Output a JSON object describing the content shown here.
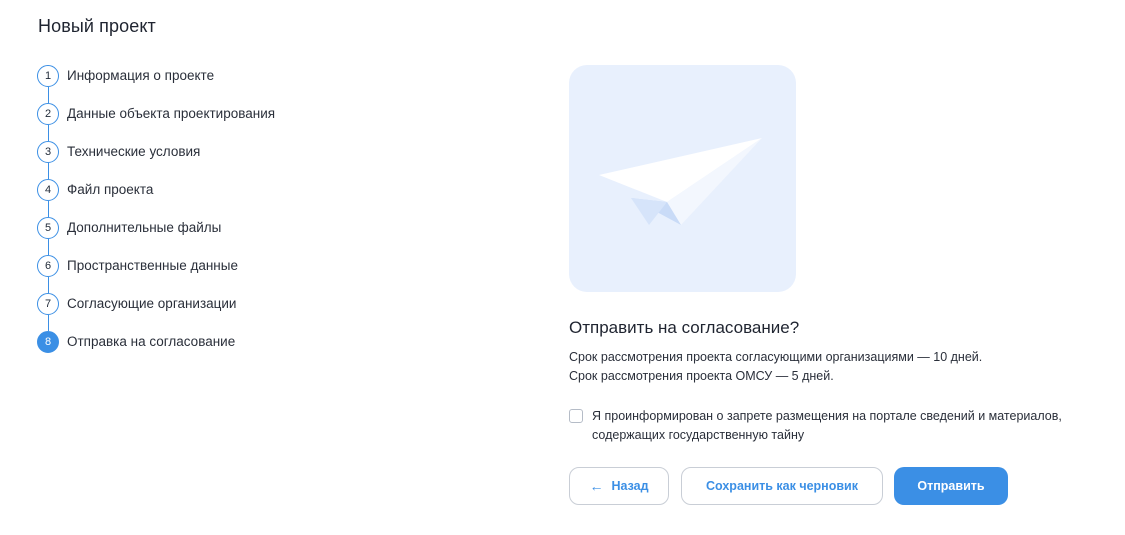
{
  "page_title": "Новый проект",
  "steps": [
    {
      "num": "1",
      "label": "Информация о проекте",
      "active": false
    },
    {
      "num": "2",
      "label": "Данные объекта проектирования",
      "active": false
    },
    {
      "num": "3",
      "label": "Технические условия",
      "active": false
    },
    {
      "num": "4",
      "label": "Файл проекта",
      "active": false
    },
    {
      "num": "5",
      "label": "Дополнительные файлы",
      "active": false
    },
    {
      "num": "6",
      "label": "Пространственные данные",
      "active": false
    },
    {
      "num": "7",
      "label": "Согласующие организации",
      "active": false
    },
    {
      "num": "8",
      "label": "Отправка на согласование",
      "active": true
    }
  ],
  "illustration": {
    "icon": "paper-plane-icon"
  },
  "dialog": {
    "title": "Отправить на согласование?",
    "line1": "Срок рассмотрения проекта согласующими организациями — 10 дней.",
    "line2": "Срок рассмотрения проекта ОМСУ — 5 дней.",
    "consent_line1": "Я проинформирован о запрете размещения на портале сведений и материалов,",
    "consent_line2": "содержащих государственную тайну",
    "consent_checked": false
  },
  "buttons": {
    "back": "Назад",
    "draft": "Сохранить как черновик",
    "submit": "Отправить"
  },
  "colors": {
    "accent": "#3b8fe5",
    "illustration_bg": "#e8f0fd"
  }
}
